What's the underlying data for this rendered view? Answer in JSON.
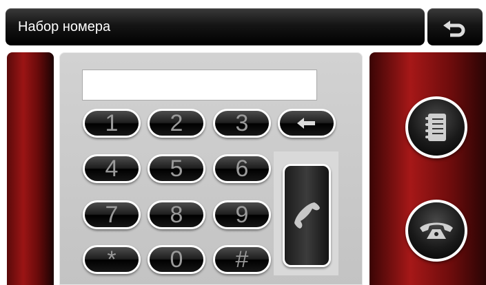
{
  "header": {
    "title": "Набор номера",
    "back_icon": "back-arrow-icon"
  },
  "display": {
    "number": ""
  },
  "keypad": {
    "keys": [
      "1",
      "2",
      "3",
      "4",
      "5",
      "6",
      "7",
      "8",
      "9",
      "*",
      "0",
      "#"
    ],
    "backspace_icon": "backspace-arrow-icon"
  },
  "actions": {
    "call_icon": "phone-call-icon",
    "contacts_icon": "contacts-list-icon",
    "hangup_icon": "phone-hangup-icon"
  },
  "colors": {
    "title_text": "#ffffff",
    "key_text": "#9a9a9a",
    "side_panel_red": "#9b1515"
  }
}
